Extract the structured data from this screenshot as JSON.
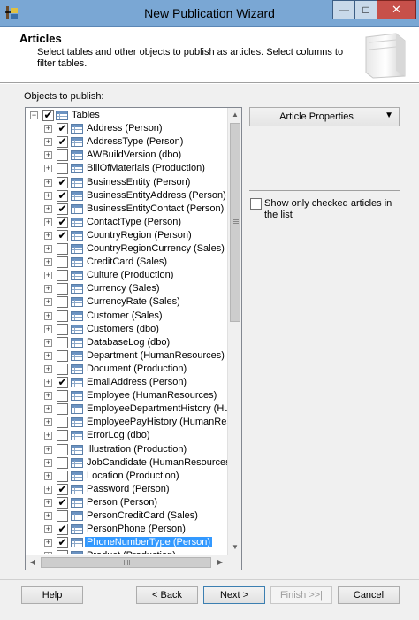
{
  "window": {
    "title": "New Publication Wizard",
    "minimize": "—",
    "maximize": "□",
    "close": "✕"
  },
  "header": {
    "title": "Articles",
    "description": "Select tables and other objects to publish as articles. Select columns to filter tables."
  },
  "objects_label": "Objects to publish:",
  "tree": {
    "root": {
      "label": "Tables",
      "expander": "−",
      "checked": true
    },
    "items": [
      {
        "label": "Address (Person)",
        "checked": true
      },
      {
        "label": "AddressType (Person)",
        "checked": true
      },
      {
        "label": "AWBuildVersion (dbo)",
        "checked": false
      },
      {
        "label": "BillOfMaterials (Production)",
        "checked": false
      },
      {
        "label": "BusinessEntity (Person)",
        "checked": true
      },
      {
        "label": "BusinessEntityAddress (Person)",
        "checked": true
      },
      {
        "label": "BusinessEntityContact (Person)",
        "checked": true
      },
      {
        "label": "ContactType (Person)",
        "checked": true
      },
      {
        "label": "CountryRegion (Person)",
        "checked": true
      },
      {
        "label": "CountryRegionCurrency (Sales)",
        "checked": false
      },
      {
        "label": "CreditCard (Sales)",
        "checked": false
      },
      {
        "label": "Culture (Production)",
        "checked": false
      },
      {
        "label": "Currency (Sales)",
        "checked": false
      },
      {
        "label": "CurrencyRate (Sales)",
        "checked": false
      },
      {
        "label": "Customer (Sales)",
        "checked": false
      },
      {
        "label": "Customers (dbo)",
        "checked": false
      },
      {
        "label": "DatabaseLog (dbo)",
        "checked": false
      },
      {
        "label": "Department (HumanResources)",
        "checked": false
      },
      {
        "label": "Document (Production)",
        "checked": false
      },
      {
        "label": "EmailAddress (Person)",
        "checked": true
      },
      {
        "label": "Employee (HumanResources)",
        "checked": false
      },
      {
        "label": "EmployeeDepartmentHistory (Human",
        "checked": false
      },
      {
        "label": "EmployeePayHistory (HumanResour",
        "checked": false
      },
      {
        "label": "ErrorLog (dbo)",
        "checked": false
      },
      {
        "label": "Illustration (Production)",
        "checked": false
      },
      {
        "label": "JobCandidate (HumanResources)",
        "checked": false
      },
      {
        "label": "Location (Production)",
        "checked": false
      },
      {
        "label": "Password (Person)",
        "checked": true
      },
      {
        "label": "Person (Person)",
        "checked": true
      },
      {
        "label": "PersonCreditCard (Sales)",
        "checked": false
      },
      {
        "label": "PersonPhone (Person)",
        "checked": true
      },
      {
        "label": "PhoneNumberType (Person)",
        "checked": true,
        "selected": true
      },
      {
        "label": "Product (Production)",
        "checked": false
      }
    ],
    "check_glyph": "✔",
    "expander_glyph": "+",
    "scroll_up": "▲",
    "scroll_down": "▼",
    "scroll_left": "◀",
    "scroll_right": "▶"
  },
  "article_properties": {
    "label": "Article Properties",
    "arrow": "▼"
  },
  "show_checked": {
    "label": "Show only checked articles in the list",
    "checked": false
  },
  "footer": {
    "help": "Help",
    "back": "< Back",
    "next": "Next >",
    "finish": "Finish >>|",
    "cancel": "Cancel"
  },
  "colors": {
    "titlebar": "#7aa7d4",
    "selection": "#3399ff",
    "close_button": "#c7504a"
  }
}
